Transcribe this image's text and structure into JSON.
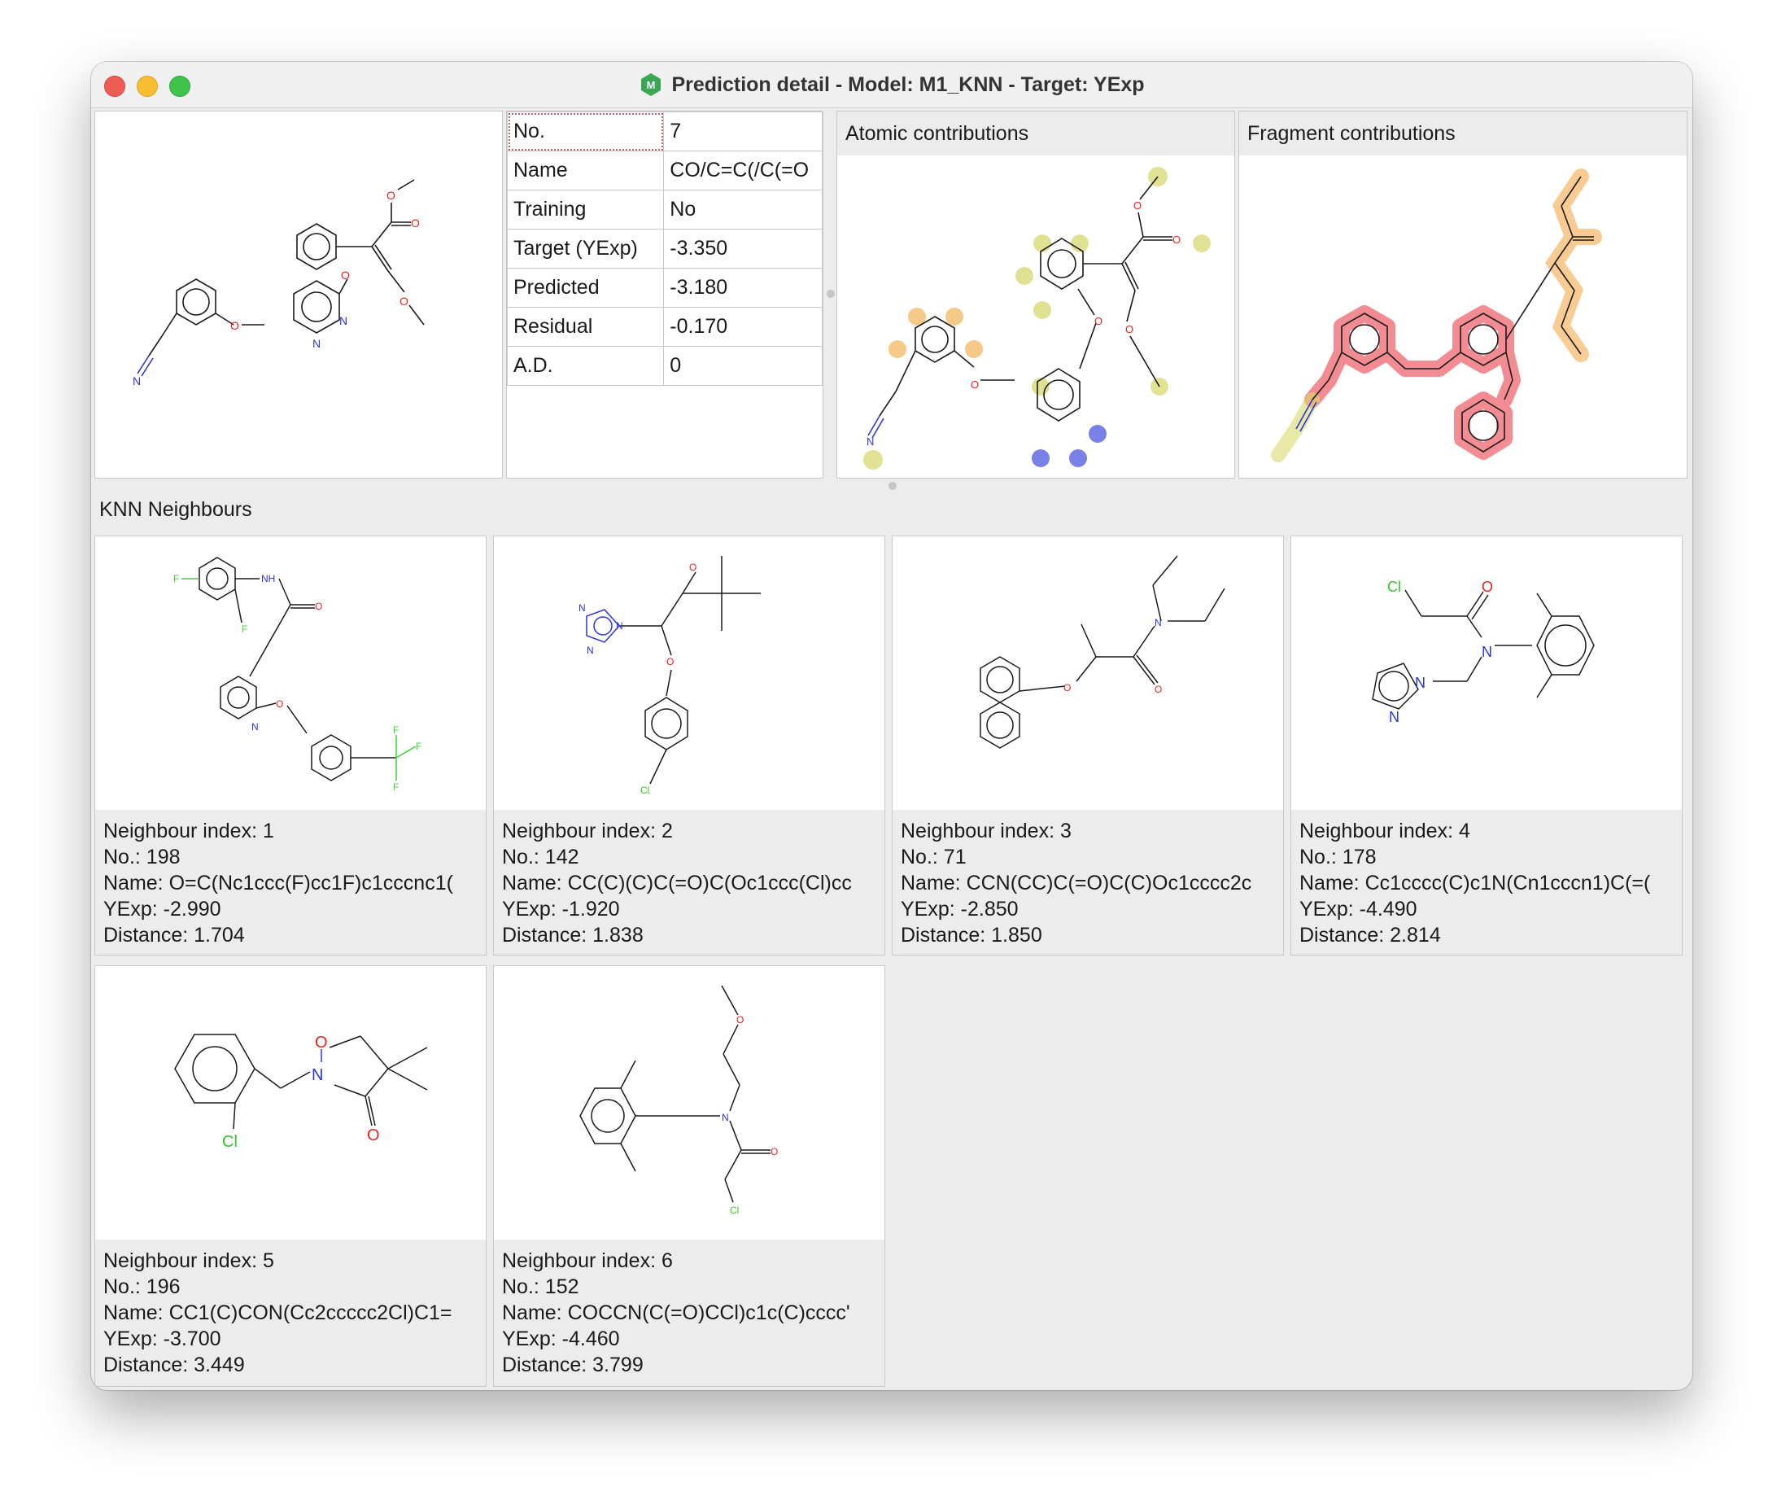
{
  "window": {
    "title": "Prediction detail - Model: M1_KNN - Target: YExp",
    "app_icon_letter": "M"
  },
  "properties": [
    {
      "key": "No.",
      "value": "7"
    },
    {
      "key": "Name",
      "value": "CO/C=C(/C(=O"
    },
    {
      "key": "Training",
      "value": "No"
    },
    {
      "key": "Target (YExp)",
      "value": "-3.350"
    },
    {
      "key": "Predicted",
      "value": "-3.180"
    },
    {
      "key": "Residual",
      "value": "-0.170"
    },
    {
      "key": "A.D.",
      "value": "0"
    }
  ],
  "atomic_panel": {
    "title": "Atomic contributions"
  },
  "fragment_panel": {
    "title": "Fragment contributions"
  },
  "neighbours_label": "KNN Neighbours",
  "neighbours": [
    {
      "index_label": "Neighbour index: 1",
      "no_label": "No.: 198",
      "name_label": "Name: O=C(Nc1ccc(F)cc1F)c1cccnc1(",
      "yexp_label": "YExp: -2.990",
      "distance_label": "Distance: 1.704"
    },
    {
      "index_label": "Neighbour index: 2",
      "no_label": "No.: 142",
      "name_label": "Name: CC(C)(C)C(=O)C(Oc1ccc(Cl)cc",
      "yexp_label": "YExp: -1.920",
      "distance_label": "Distance: 1.838"
    },
    {
      "index_label": "Neighbour index: 3",
      "no_label": "No.: 71",
      "name_label": "Name: CCN(CC)C(=O)C(C)Oc1cccc2c",
      "yexp_label": "YExp: -2.850",
      "distance_label": "Distance: 1.850"
    },
    {
      "index_label": "Neighbour index: 4",
      "no_label": "No.: 178",
      "name_label": "Name: Cc1cccc(C)c1N(Cn1cccn1)C(=(",
      "yexp_label": "YExp: -4.490",
      "distance_label": "Distance: 2.814"
    },
    {
      "index_label": "Neighbour index: 5",
      "no_label": "No.: 196",
      "name_label": "Name: CC1(C)CON(Cc2ccccc2Cl)C1=",
      "yexp_label": "YExp: -3.700",
      "distance_label": "Distance: 3.449"
    },
    {
      "index_label": "Neighbour index: 6",
      "no_label": "No.: 152",
      "name_label": "Name: COCCN(C(=O)CCl)c1c(C)cccc'",
      "yexp_label": "YExp: -4.460",
      "distance_label": "Distance: 3.799"
    }
  ],
  "atom_labels": {
    "O": "O",
    "N": "N",
    "F": "F",
    "Cl": "Cl",
    "NH": "NH"
  },
  "colors": {
    "oxygen": "#e8231e",
    "nitrogen": "#2a36d8",
    "fluorine": "#3fd13a",
    "chlorine": "#35c42a",
    "highlight_red": "#e8303a",
    "highlight_orange": "#f2a23a",
    "highlight_yellow": "#d8d870",
    "highlight_blue": "#5a62e0"
  }
}
